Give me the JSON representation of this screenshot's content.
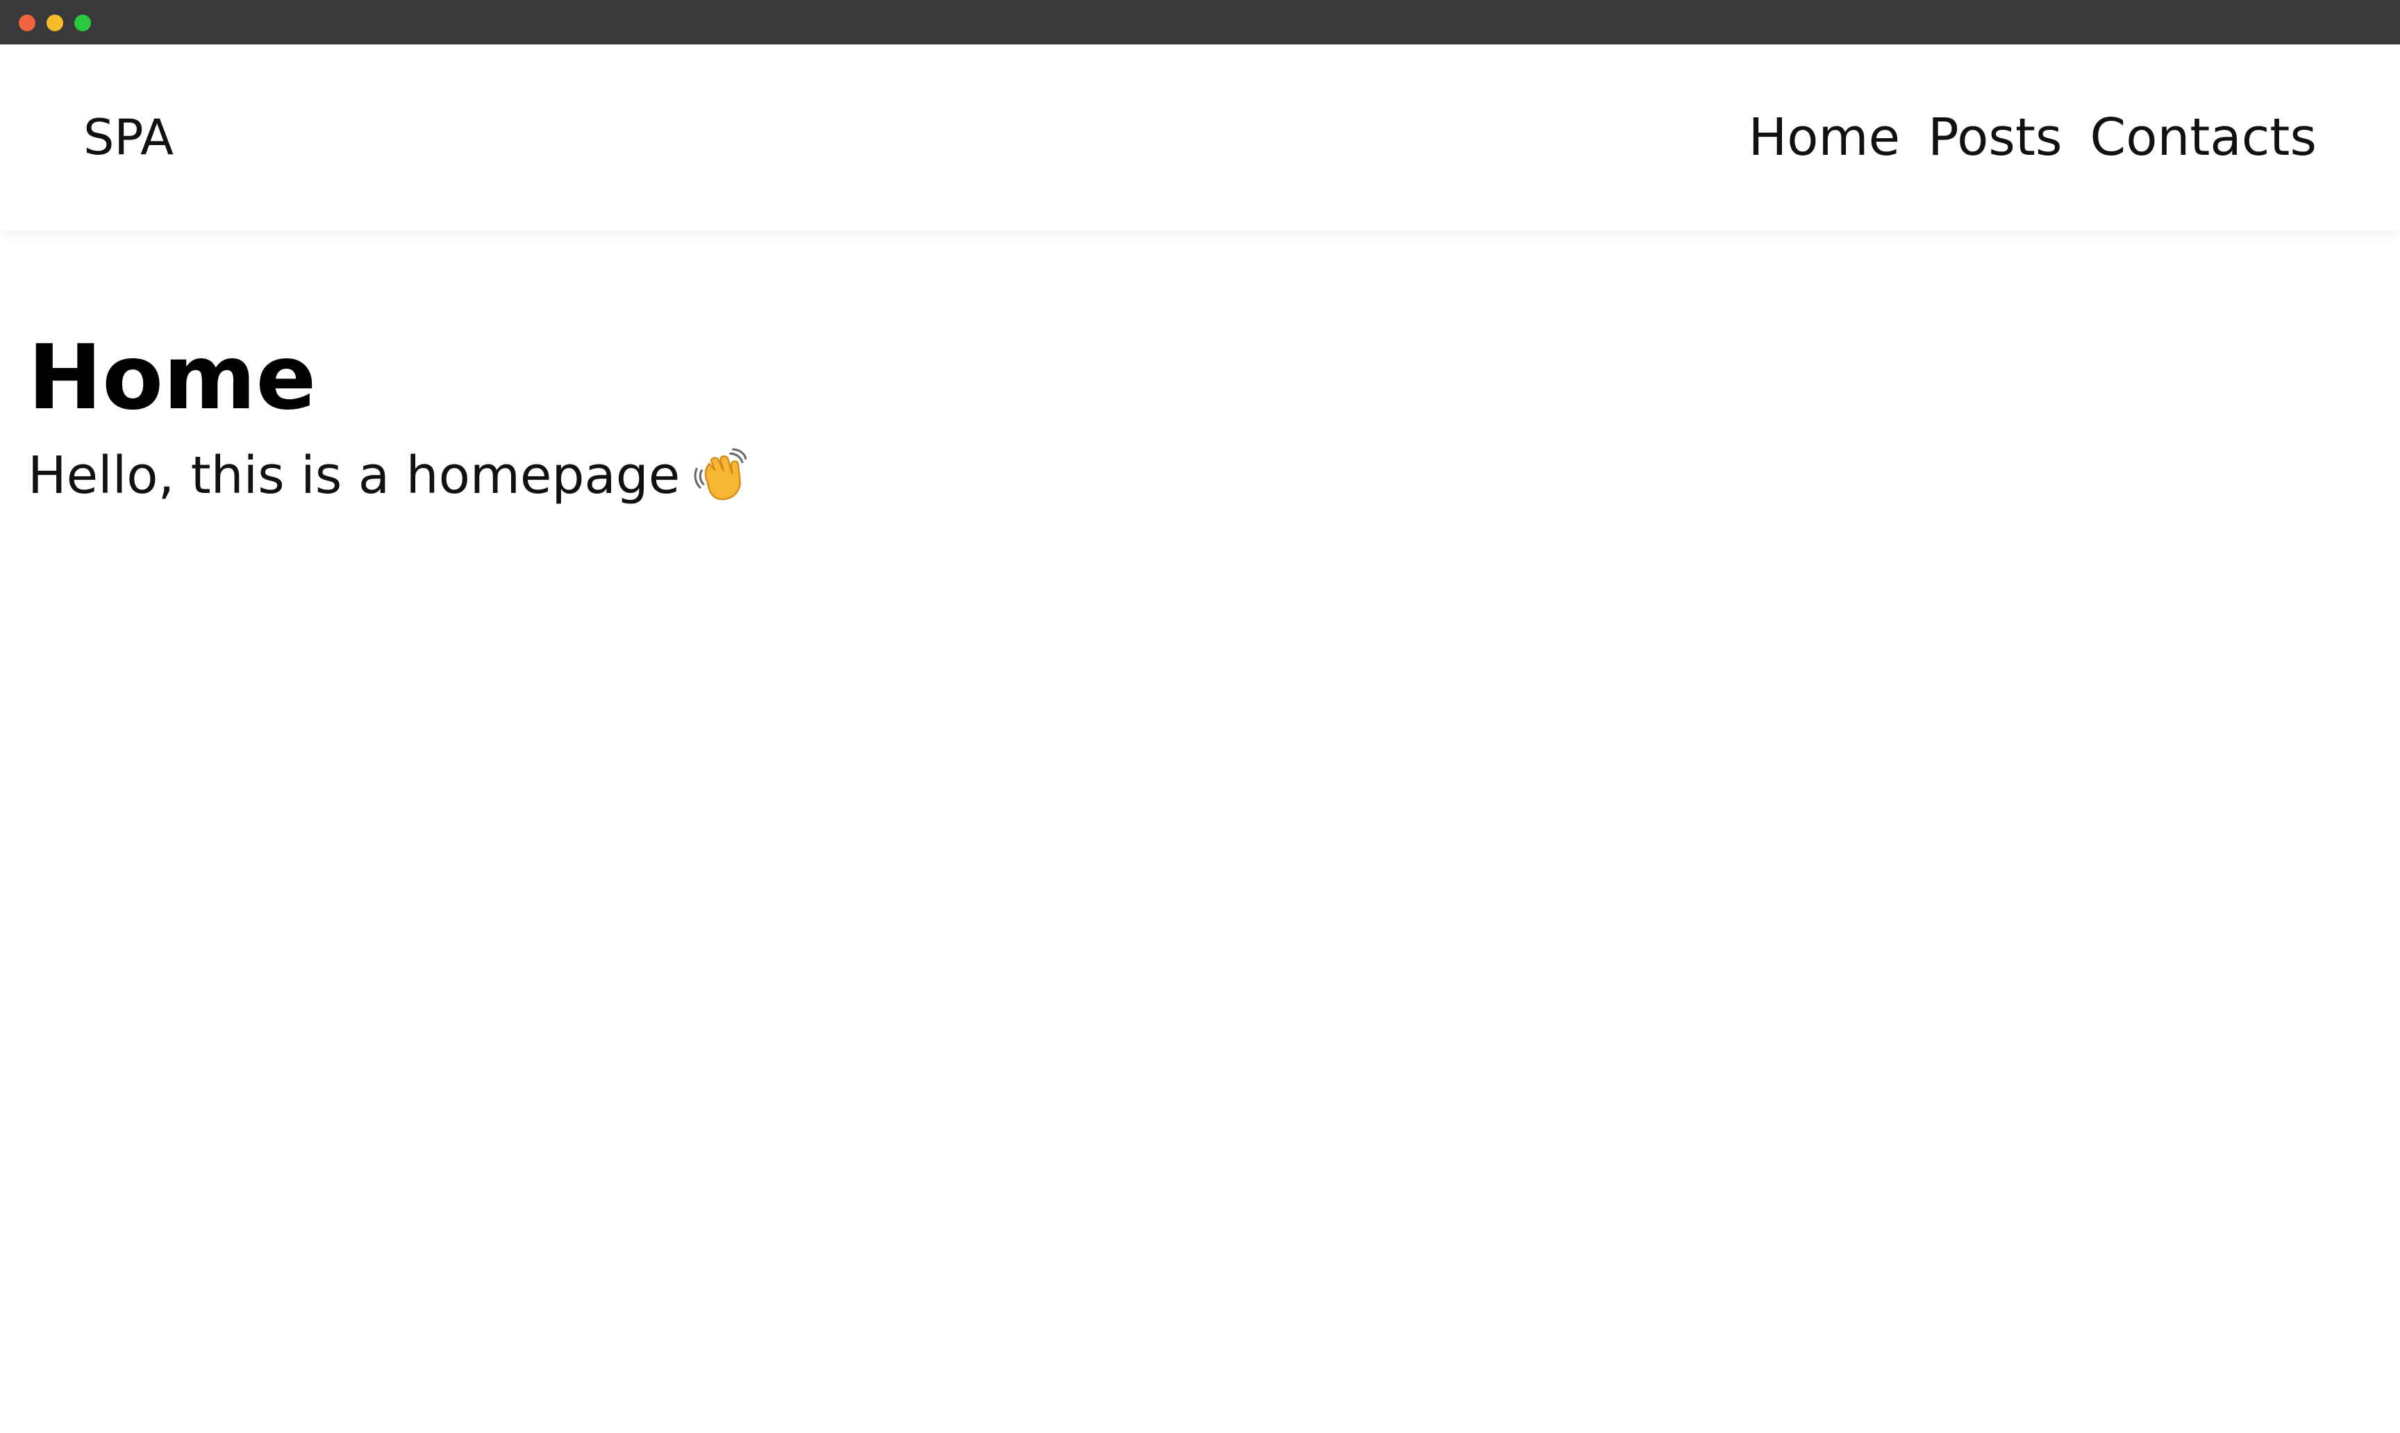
{
  "window": {
    "controls": [
      "close",
      "minimize",
      "maximize"
    ]
  },
  "navbar": {
    "brand": "SPA",
    "links": [
      {
        "label": "Home"
      },
      {
        "label": "Posts"
      },
      {
        "label": "Contacts"
      }
    ]
  },
  "main": {
    "title": "Home",
    "text": "Hello, this is a homepage",
    "icon": "waving-hand-icon"
  },
  "colors": {
    "titlebar": "#38393b",
    "close": "#f0643d",
    "minimize": "#f5bd2a",
    "maximize": "#28c840",
    "wave": "#f7b733"
  }
}
